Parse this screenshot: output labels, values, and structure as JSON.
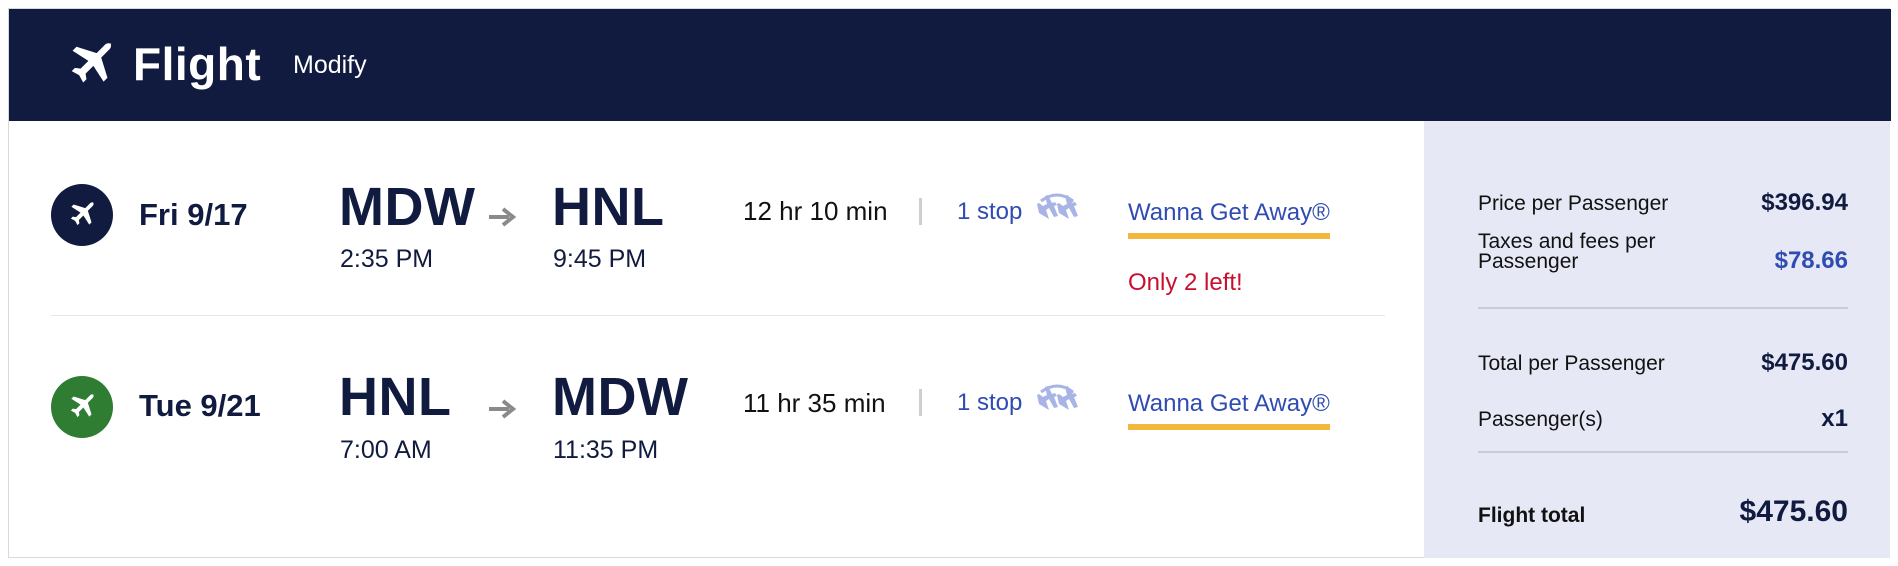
{
  "header": {
    "title": "Flight",
    "modify_label": "Modify"
  },
  "flights": [
    {
      "date": "Fri 9/17",
      "origin_code": "MDW",
      "origin_time": "2:35 PM",
      "dest_code": "HNL",
      "dest_time": "9:45 PM",
      "duration": "12 hr 10 min",
      "stops": "1 stop",
      "fare": "Wanna Get Away®",
      "seats_left": "Only 2 left!",
      "badge_color": "#111b40"
    },
    {
      "date": "Tue 9/21",
      "origin_code": "HNL",
      "origin_time": "7:00 AM",
      "dest_code": "MDW",
      "dest_time": "11:35 PM",
      "duration": "11 hr 35 min",
      "stops": "1 stop",
      "fare": "Wanna Get Away®",
      "badge_color": "#2e7d32"
    }
  ],
  "summary": {
    "price_label": "Price per Passenger",
    "price_value": "$396.94",
    "taxes_label_line1": "Taxes and fees per",
    "taxes_label_line2": "Passenger",
    "taxes_value": "$78.66",
    "total_per_label": "Total per Passenger",
    "total_per_value": "$475.60",
    "passengers_label": "Passenger(s)",
    "passengers_value": "x1",
    "flight_total_label": "Flight total",
    "flight_total_value": "$475.60"
  },
  "colors": {
    "header_bg": "#111b40",
    "link_blue": "#304cb2",
    "fare_underline": "#f2b73c",
    "warning_red": "#c8102e",
    "summary_bg": "#e6e8f5"
  },
  "icons": {
    "header": "airplane-icon",
    "arrow": "arrow-right-icon",
    "stop": "connecting-flight-icon"
  }
}
